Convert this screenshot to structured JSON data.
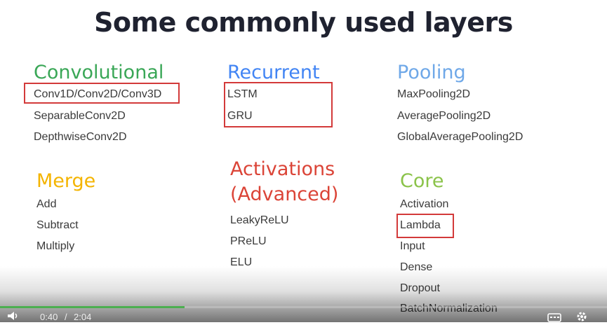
{
  "slide": {
    "title": "Some commonly used layers",
    "groups": [
      {
        "heading": "Convolutional",
        "color": "#3aa757",
        "items": [
          "Conv1D/Conv2D/Conv3D",
          "SeparableConv2D",
          "DepthwiseConv2D"
        ]
      },
      {
        "heading": "Recurrent",
        "color": "#4285f4",
        "items": [
          "LSTM",
          "GRU"
        ]
      },
      {
        "heading": "Pooling",
        "color": "#6fa8e8",
        "items": [
          "MaxPooling2D",
          "AveragePooling2D",
          "GlobalAveragePooling2D"
        ]
      },
      {
        "heading": "Merge",
        "color": "#f4b400",
        "items": [
          "Add",
          "Subtract",
          "Multiply"
        ]
      },
      {
        "heading_lines": [
          "Activations",
          "(Advanced)"
        ],
        "color": "#db4437",
        "items": [
          "LeakyReLU",
          "PReLU",
          "ELU"
        ]
      },
      {
        "heading": "Core",
        "color": "#8bc34a",
        "items": [
          "Activation",
          "Lambda",
          "Input",
          "Dense",
          "Dropout",
          "BatchNormalization"
        ]
      }
    ],
    "highlight_color": "#d33a3a"
  },
  "player": {
    "current_time": "0:40",
    "separator": "/",
    "duration": "2:04",
    "progress_fraction": 0.304,
    "progress_color": "#4caf50",
    "icons": [
      "volume-icon",
      "captions-icon",
      "settings-icon"
    ]
  }
}
